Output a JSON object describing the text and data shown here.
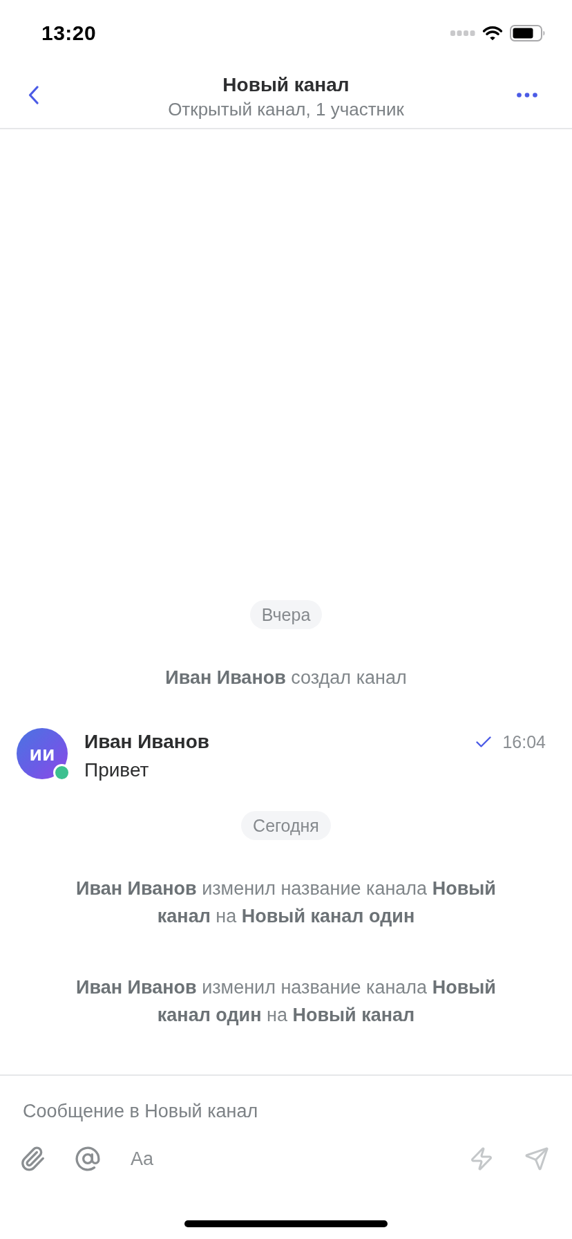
{
  "status_bar": {
    "time": "13:20"
  },
  "header": {
    "title": "Новый канал",
    "subtitle": "Открытый канал, 1 участник"
  },
  "feed": [
    {
      "kind": "date",
      "text": "Вчера"
    },
    {
      "kind": "system",
      "text": "**Иван Иванов** создал канал"
    },
    {
      "kind": "message",
      "initials": "ии",
      "online": true,
      "author": "Иван Иванов",
      "read": true,
      "time": "16:04",
      "text": "Привет"
    },
    {
      "kind": "date",
      "text": "Сегодня"
    },
    {
      "kind": "system",
      "text": "**Иван Иванов** изменил название канала **Новый канал** на **Новый канал один**"
    },
    {
      "kind": "system",
      "text": "**Иван Иванов** изменил название канала **Новый канал один** на **Новый канал**"
    }
  ],
  "composer": {
    "placeholder": "Сообщение в Новый канал",
    "format_label": "Aa",
    "send_disabled": true
  }
}
